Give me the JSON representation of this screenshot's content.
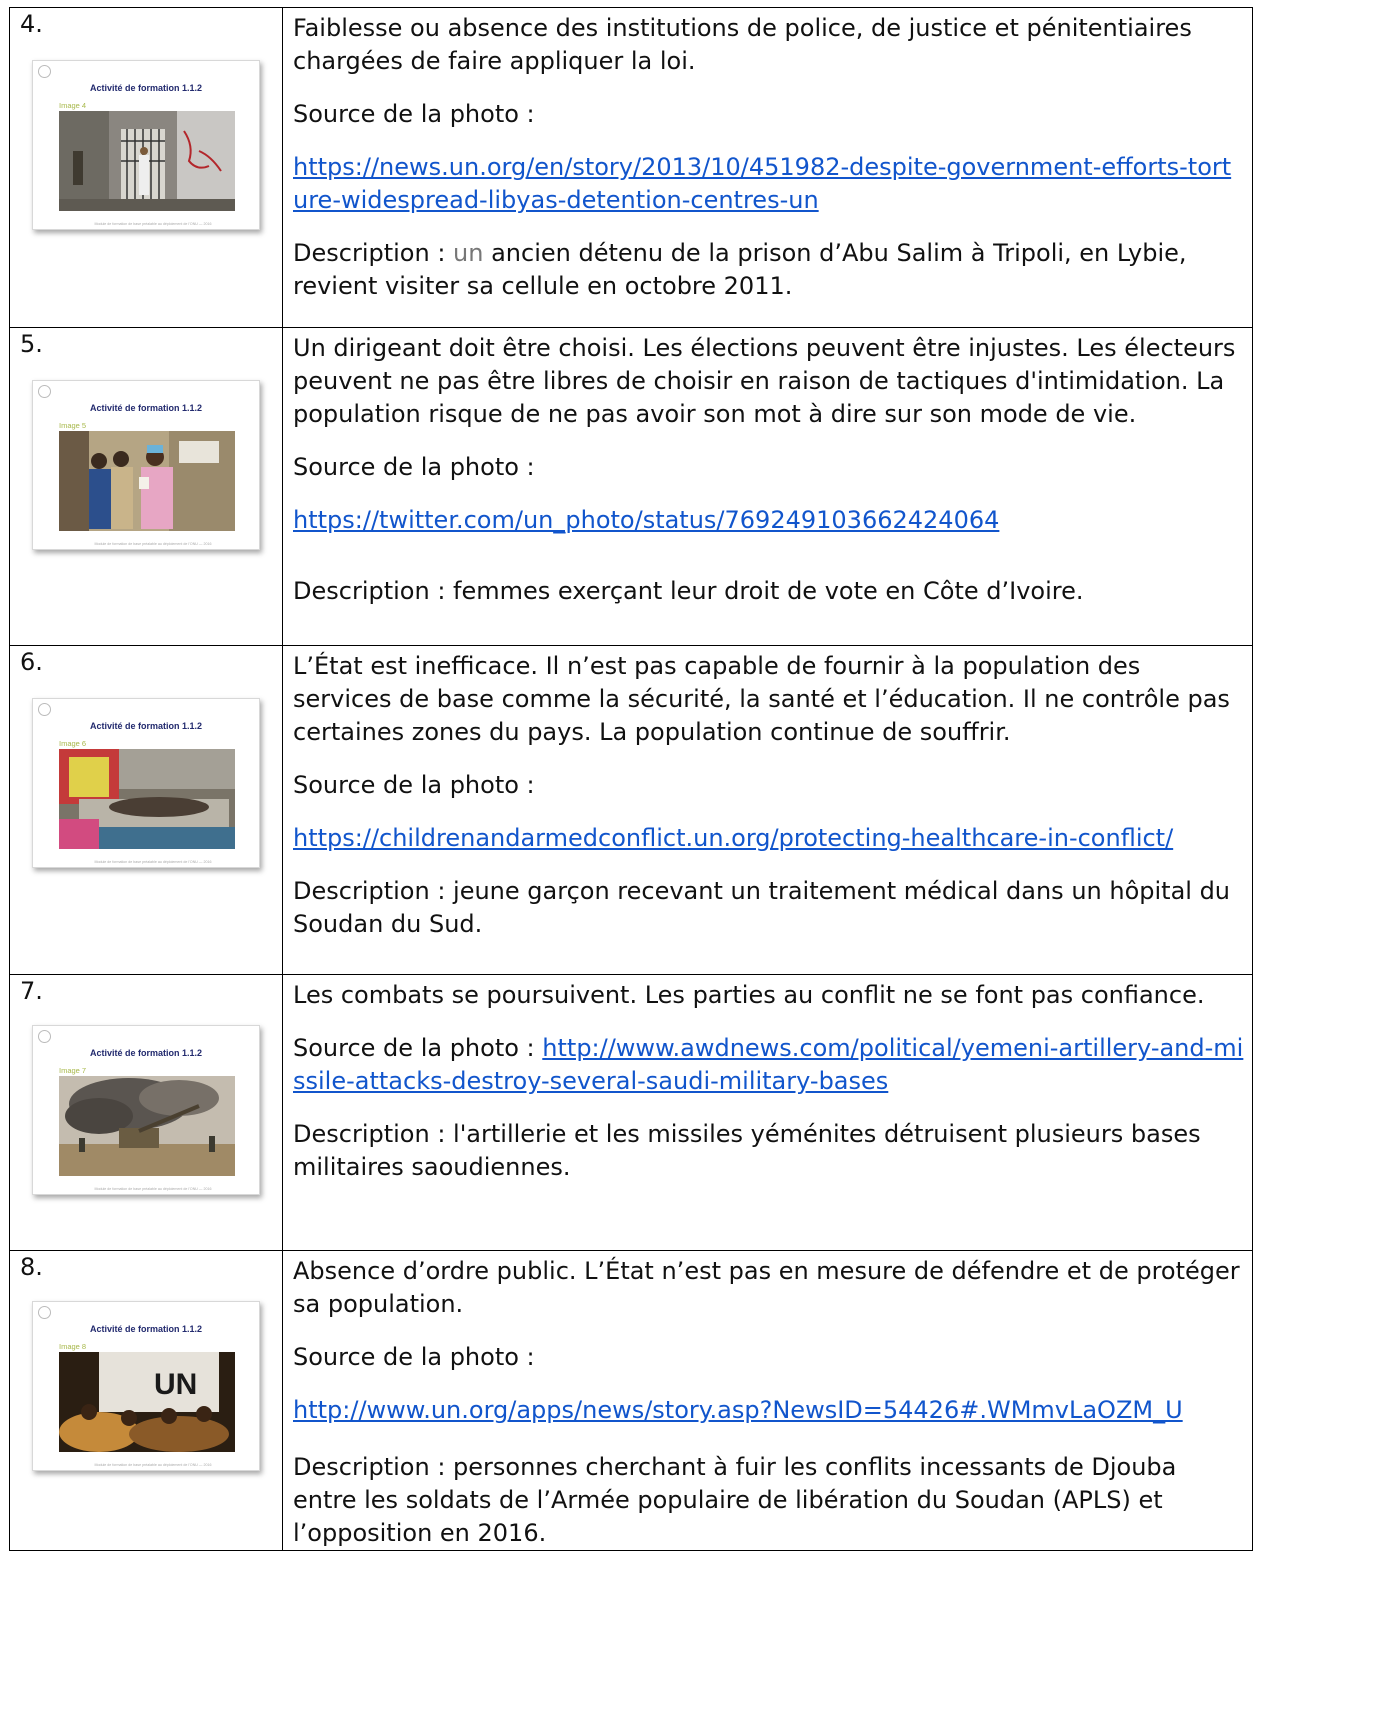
{
  "slide_title": "Activité de formation 1.1.2",
  "slide_footer": "Module de formation de base préalable au déploiement de l'ONU — 2016",
  "rows": [
    {
      "number": "4.",
      "image_label": "Image 4",
      "paragraph": "Faiblesse ou absence des institutions de police, de justice et pénitentiaires chargées de faire appliquer la loi.",
      "source_label": "Source de la photo :",
      "link": " https://news.un.org/en/story/2013/10/451982-despite-government-efforts-torture-widespread-libyas-detention-centres-un",
      "description_prefix": "Description : ",
      "description_highlight": "un",
      "description_rest": " ancien détenu de la prison d’Abu Salim à Tripoli, en Lybie, revient visiter sa cellule en octobre 2011."
    },
    {
      "number": "5.",
      "image_label": "Image 5",
      "paragraph": "Un dirigeant doit être choisi. Les élections peuvent être injustes. Les électeurs peuvent ne pas être libres de choisir en raison de tactiques d'intimidation. La population risque de ne pas avoir son mot à dire sur son mode de vie.",
      "source_label": "Source de la photo :",
      "link": "https://twitter.com/un_photo/status/769249103662424064",
      "description": "Description : femmes exerçant leur droit de vote en Côte d’Ivoire."
    },
    {
      "number": "6.",
      "image_label": "Image 6",
      "paragraph": "L’État est inefficace. Il n’est pas capable de fournir à la population des services de base comme la sécurité, la santé et l’éducation. Il ne contrôle pas certaines zones du pays. La population continue de souffrir.",
      "source_label": "Source de la photo :",
      "link": "https://childrenandarmedconflict.un.org/protecting-healthcare-in-conflict/",
      "description": "Description : jeune garçon recevant un traitement médical dans un hôpital du Soudan du Sud."
    },
    {
      "number": "7.",
      "image_label": "Image 7",
      "paragraph": "Les combats se poursuivent. Les parties au conflit ne se font pas confiance.",
      "source_label": "Source de la photo :",
      "link": " http://www.awdnews.com/political/yemeni-artillery-and-missile-attacks-destroy-several-saudi-military-bases",
      "description": "Description : l'artillerie et les missiles yéménites détruisent plusieurs bases militaires saoudiennes."
    },
    {
      "number": "8.",
      "image_label": "Image 8",
      "paragraph": "Absence d’ordre public. L’État n’est pas en mesure de défendre et de protéger sa population.",
      "source_label": "Source de la photo :",
      "link": "http://www.un.org/apps/news/story.asp?NewsID=54426#.WMmvLaOZM_U",
      "description": "Description : personnes cherchant à fuir les conflits incessants de Djouba entre les soldats de l’Armée populaire de libération du Soudan (APLS) et l’opposition en 2016."
    }
  ]
}
